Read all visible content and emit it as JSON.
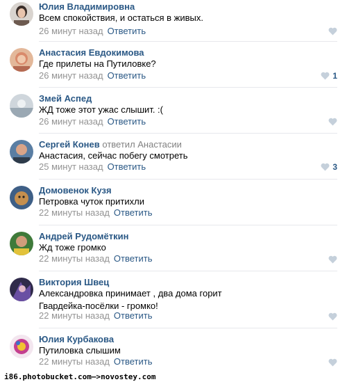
{
  "comments": [
    {
      "author": "Юлия Владимировна",
      "reply_to": "",
      "text": [
        "Всем спокойствия, и остаться в живых."
      ],
      "time": "26 минут назад",
      "reply_label": "Ответить",
      "likes": ""
    },
    {
      "author": "Анастасия Евдокимова",
      "reply_to": "",
      "text": [
        "Где прилеты на Путиловке?"
      ],
      "time": "26 минут назад",
      "reply_label": "Ответить",
      "likes": "1"
    },
    {
      "author": "Змей Аспед",
      "reply_to": "",
      "text": [
        "ЖД тоже этот ужас слышит. :("
      ],
      "time": "26 минут назад",
      "reply_label": "Ответить",
      "likes": ""
    },
    {
      "author": "Сергей Конев",
      "reply_to": "ответил Анастасии",
      "text": [
        "Анастасия, сейчас побегу смотреть"
      ],
      "time": "25 минут назад",
      "reply_label": "Ответить",
      "likes": "3"
    },
    {
      "author": "Домовенок Кузя",
      "reply_to": "",
      "text": [
        "Петровка чуток притихли"
      ],
      "time": "22 минуты назад",
      "reply_label": "Ответить",
      "likes": ""
    },
    {
      "author": "Андрей Рудомёткин",
      "reply_to": "",
      "text": [
        "Жд тоже громко"
      ],
      "time": "22 минуты назад",
      "reply_label": "Ответить",
      "likes": ""
    },
    {
      "author": "Виктория Швец",
      "reply_to": "",
      "text": [
        "Александровка принимает , два дома горит",
        "Гвардейка-посёлки - громко!"
      ],
      "time": "22 минуты назад",
      "reply_label": "Ответить",
      "likes": ""
    },
    {
      "author": "Юлия Курбакова",
      "reply_to": "",
      "text": [
        "Путиловка слышим"
      ],
      "time": "22 минуты назад",
      "reply_label": "Ответить",
      "likes": ""
    }
  ],
  "watermark": "i86.photobucket.com—>novostey.com",
  "colors": {
    "link": "#2a5885",
    "meta": "#939393",
    "divider": "#e7e8ec",
    "like_icon": "#c5d0db"
  }
}
